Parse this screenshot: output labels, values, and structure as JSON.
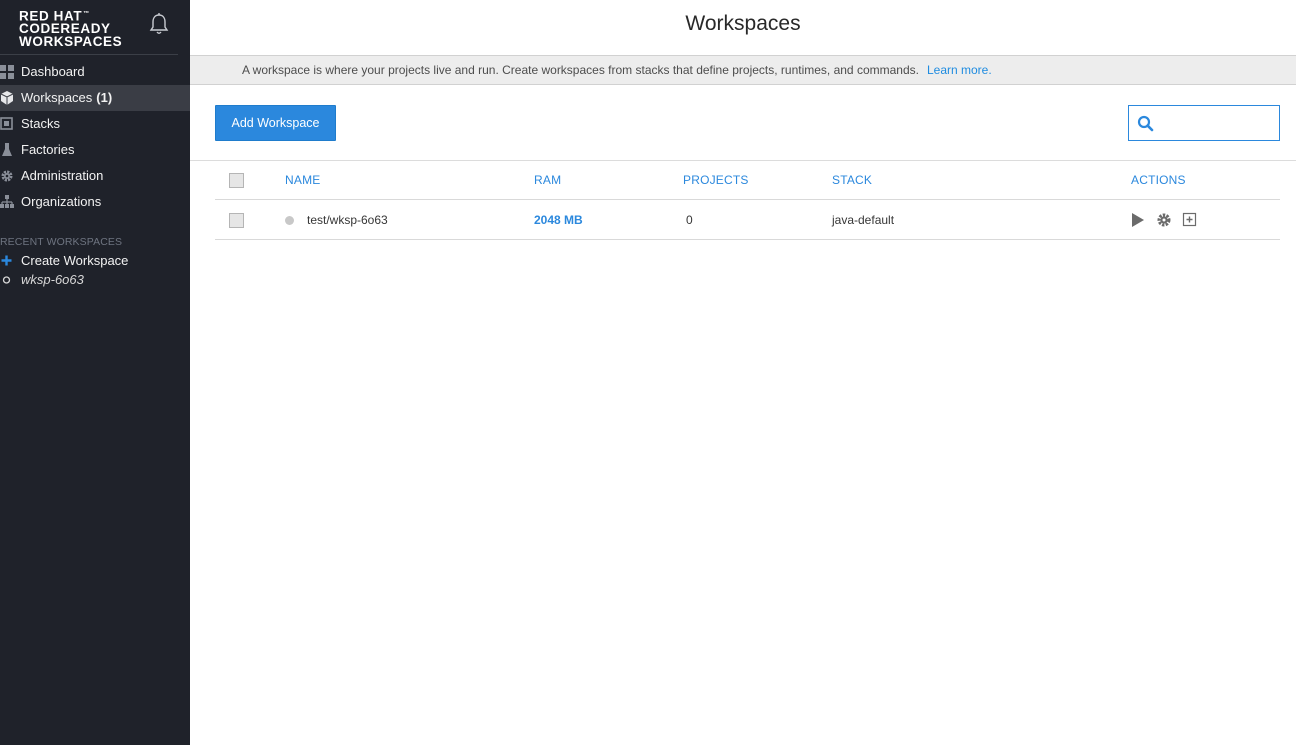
{
  "brand": {
    "line1": "RED HAT",
    "line2": "CODEREADY",
    "line3": "WORKSPACES"
  },
  "sidebar": {
    "items": [
      {
        "label": "Dashboard",
        "icon": "dashboard-icon"
      },
      {
        "label": "Workspaces",
        "count": "(1)",
        "icon": "workspaces-cube-icon"
      },
      {
        "label": "Stacks",
        "icon": "stacks-icon"
      },
      {
        "label": "Factories",
        "icon": "factories-icon"
      },
      {
        "label": "Administration",
        "icon": "gear-icon"
      },
      {
        "label": "Organizations",
        "icon": "organizations-icon"
      }
    ],
    "recent_title": "RECENT WORKSPACES",
    "recent": [
      {
        "label": "Create Workspace",
        "icon": "plus-icon"
      },
      {
        "label": "wksp-6o63",
        "icon": "circle-icon"
      }
    ]
  },
  "header": {
    "title": "Workspaces"
  },
  "info": {
    "text": "A workspace is where your projects live and run. Create workspaces from stacks that define projects, runtimes, and commands.",
    "link": "Learn more."
  },
  "toolbar": {
    "add_label": "Add Workspace",
    "search_value": ""
  },
  "table": {
    "columns": [
      "NAME",
      "RAM",
      "PROJECTS",
      "STACK",
      "ACTIONS"
    ],
    "rows": [
      {
        "name": "test/wksp-6o63",
        "ram": "2048 MB",
        "projects": "0",
        "stack": "java-default",
        "status": "stopped"
      }
    ]
  },
  "colors": {
    "sidebar_bg": "#1f222a",
    "accent": "#2b88dd",
    "info_bg": "#ededed"
  }
}
